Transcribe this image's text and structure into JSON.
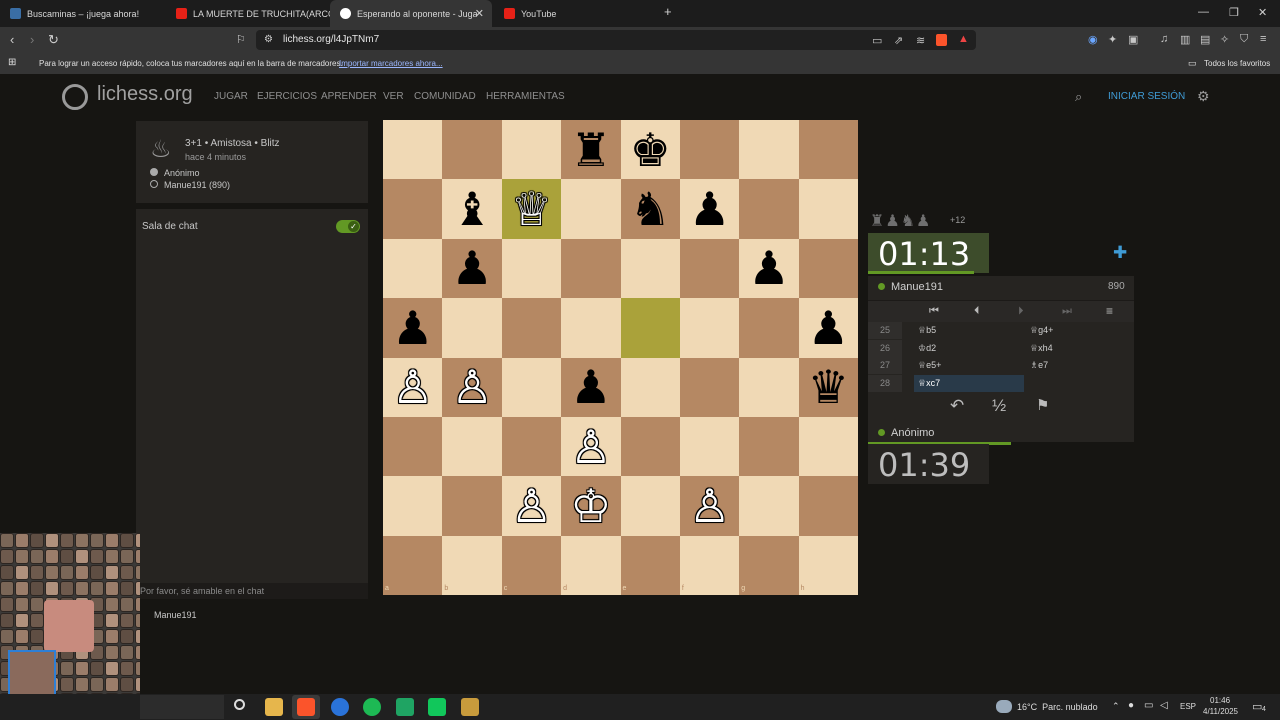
{
  "browser": {
    "tabs": [
      {
        "title": "Buscaminas – ¡juega ahora!",
        "icon": "minesweeper-icon",
        "color": "#3a6ea5"
      },
      {
        "title": "LA MUERTE DE TRUCHITA(ARCO",
        "icon": "youtube-icon",
        "color": "#e62117"
      },
      {
        "title": "Esperando al oponente - Jugar",
        "icon": "lichess-icon",
        "color": "#ffffff"
      },
      {
        "title": "YouTube",
        "icon": "youtube-icon",
        "color": "#e62117"
      }
    ],
    "url": "lichess.org/l4JpTNm7",
    "bookmarks_hint": "Para lograr un acceso rápido, coloca tus marcadores aquí en la barra de marcadores.",
    "bookmarks_import": "Importar marcadores ahora...",
    "all_bookmarks": "Todos los favoritos"
  },
  "site": {
    "brand": "lichess.org",
    "menu": [
      "JUGAR",
      "EJERCICIOS",
      "APRENDER",
      "VER",
      "COMUNIDAD",
      "HERRAMIENTAS"
    ],
    "login": "INICIAR SESIÓN",
    "accent": "#3f9bd5"
  },
  "game": {
    "type": "3+1 • Amistosa • Blitz",
    "time_ago": "hace 4 minutos",
    "white_player": "Anónimo",
    "black_player": "Manue191 (890)",
    "chat_title": "Sala de chat",
    "chat_placeholder": "Por favor, sé amable en el chat",
    "spectator": "Manue191"
  },
  "board": {
    "ranks": [
      "8",
      "7",
      "6",
      "5",
      "4",
      "3",
      "2",
      "1"
    ],
    "files": [
      "a",
      "b",
      "c",
      "d",
      "e",
      "f",
      "g",
      "h"
    ],
    "pieces": [
      {
        "sq": "d8",
        "glyph": "♜",
        "color": "b"
      },
      {
        "sq": "e8",
        "glyph": "♚",
        "color": "b"
      },
      {
        "sq": "b7",
        "glyph": "♝",
        "color": "b"
      },
      {
        "sq": "c7",
        "glyph": "♕",
        "color": "w"
      },
      {
        "sq": "e7",
        "glyph": "♞",
        "color": "b"
      },
      {
        "sq": "f7",
        "glyph": "♟",
        "color": "b"
      },
      {
        "sq": "b6",
        "glyph": "♟",
        "color": "b"
      },
      {
        "sq": "g6",
        "glyph": "♟",
        "color": "b"
      },
      {
        "sq": "a5",
        "glyph": "♟",
        "color": "b"
      },
      {
        "sq": "h5",
        "glyph": "♟",
        "color": "b"
      },
      {
        "sq": "a4",
        "glyph": "♙",
        "color": "w"
      },
      {
        "sq": "b4",
        "glyph": "♙",
        "color": "w"
      },
      {
        "sq": "d4",
        "glyph": "♟",
        "color": "b"
      },
      {
        "sq": "h4",
        "glyph": "♛",
        "color": "b"
      },
      {
        "sq": "d3",
        "glyph": "♙",
        "color": "w"
      },
      {
        "sq": "c2",
        "glyph": "♙",
        "color": "w"
      },
      {
        "sq": "d2",
        "glyph": "♔",
        "color": "w"
      },
      {
        "sq": "f2",
        "glyph": "♙",
        "color": "w"
      }
    ],
    "highlight": [
      "c7",
      "e5"
    ]
  },
  "right": {
    "captured": "♜♟♞♟",
    "captured_plus": "+12",
    "opp_clock": "01:13",
    "opp_name": "Manue191",
    "opp_rating": "890",
    "moves": [
      {
        "n": "25",
        "w": "♕b5",
        "b": "♕g4+"
      },
      {
        "n": "26",
        "w": "♔d2",
        "b": "♕xh4"
      },
      {
        "n": "27",
        "w": "♕e5+",
        "b": "♗e7"
      },
      {
        "n": "28",
        "w": "♕xc7",
        "b": ""
      }
    ],
    "my_name": "Anónimo",
    "my_clock": "01:39",
    "draw": "½"
  },
  "taskbar": {
    "weather": "16°C  Parc. nublado",
    "lang": "ESP",
    "time": "01:46",
    "date": "4/11/2025",
    "notif": "4"
  }
}
